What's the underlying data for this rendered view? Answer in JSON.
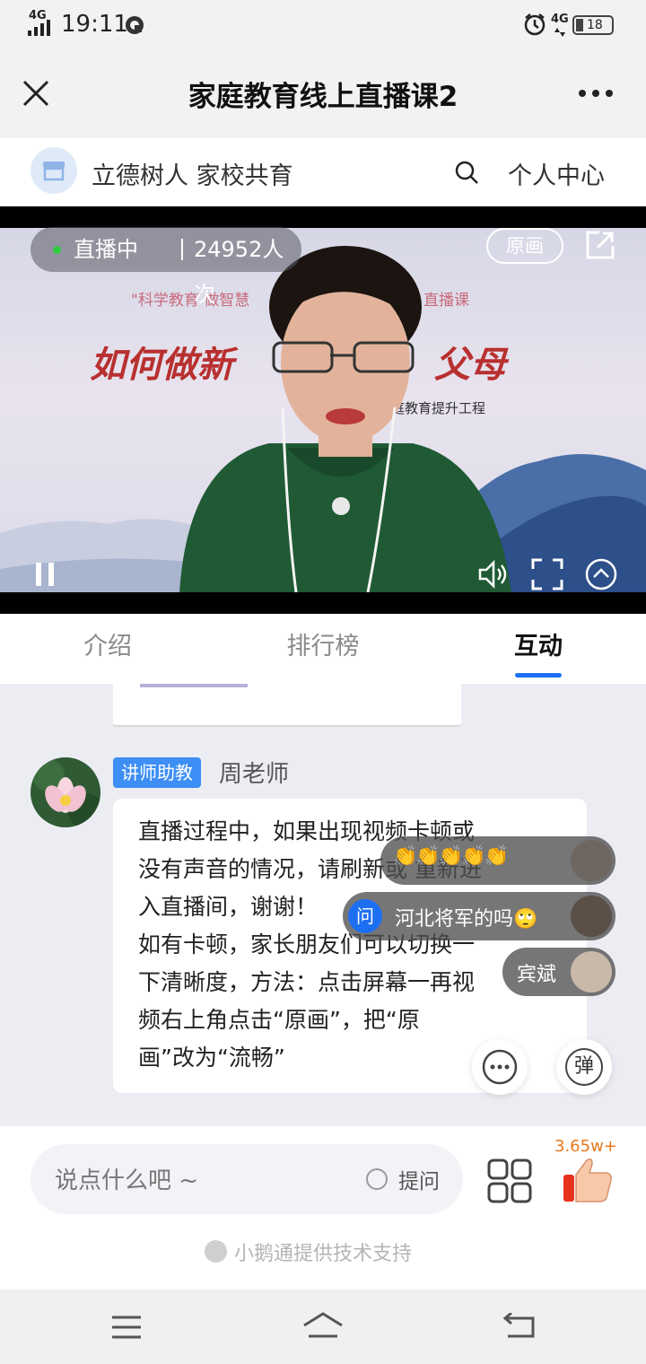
{
  "status_bar": {
    "network_left": "4G",
    "time": "19:11",
    "network_right": "4G",
    "battery": "18"
  },
  "title_bar": {
    "title": "家庭教育线上直播课2"
  },
  "shop_bar": {
    "name": "立德树人 家校共育",
    "personal_center": "个人中心"
  },
  "video": {
    "live_badge": "直播中",
    "viewer_count": "24952人次",
    "quality_button": "原画",
    "slide_line1_left": "\"科学教育 做智慧",
    "slide_line1_right": "直播课",
    "slide_title_left": "如何做新",
    "slide_title_right": "父母",
    "slide_subtitle": "庭教育提升工程"
  },
  "tabs": [
    {
      "label": "介绍"
    },
    {
      "label": "排行榜"
    },
    {
      "label": "互动"
    }
  ],
  "message": {
    "role_badge": "讲师助教",
    "author": "周老师",
    "lines": [
      "直播过程中，如果出现视频卡顿或",
      "没有声音的情况，请刷新或 重新进",
      "入直播间，谢谢！",
      "如有卡顿，家长朋友们可以切换一",
      "下清晰度，方法：点击屏幕一再视",
      "频右上角点击“原画”，把“原",
      "画”改为“流畅”"
    ]
  },
  "danmaku": [
    {
      "text": "👏👏👏👏👏"
    },
    {
      "tag": "问",
      "text": "河北将军的吗🙄"
    },
    {
      "text": "宾斌"
    }
  ],
  "danmaku_toggle": "弹",
  "bottom": {
    "input_placeholder": "说点什么吧 ~",
    "question_label": "提问",
    "like_count": "3.65w+",
    "support_text": "小鹅通提供技术支持"
  },
  "colors": {
    "accent_blue": "#1d6ff2",
    "live_green": "#2ecc40",
    "like_orange": "#e8781c",
    "badge_blue": "#3d8ef5"
  }
}
